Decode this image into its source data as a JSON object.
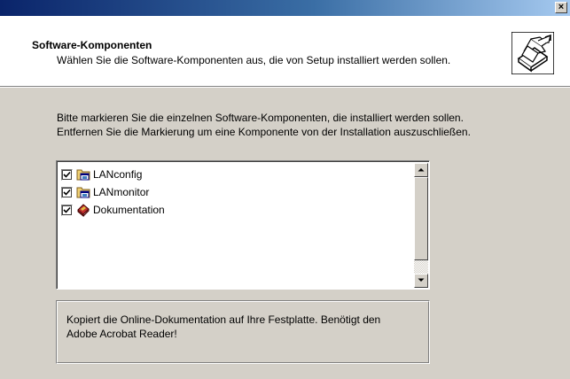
{
  "window": {
    "close_label": "×"
  },
  "header": {
    "title": "Software-Komponenten",
    "subtitle": "Wählen Sie die Software-Komponenten aus, die von Setup installiert werden sollen.",
    "icon": "setup-box-icon"
  },
  "instructions": {
    "line1": "Bitte markieren Sie die einzelnen Software-Komponenten, die installiert werden sollen.",
    "line2": "Entfernen Sie die Markierung um eine Komponente von der Installation auszuschließen."
  },
  "components": [
    {
      "label": "LANconfig",
      "checked": true,
      "icon": "program-folder-icon"
    },
    {
      "label": "LANmonitor",
      "checked": true,
      "icon": "program-folder-icon"
    },
    {
      "label": "Dokumentation",
      "checked": true,
      "icon": "documentation-book-icon"
    }
  ],
  "description": {
    "line1": "Kopiert die Online-Dokumentation auf Ihre Festplatte. Benötigt den",
    "line2": "Adobe Acrobat Reader!"
  },
  "colors": {
    "titlebar_start": "#0a246a",
    "titlebar_end": "#a6caf0",
    "dialog_bg": "#d4d0c8"
  }
}
